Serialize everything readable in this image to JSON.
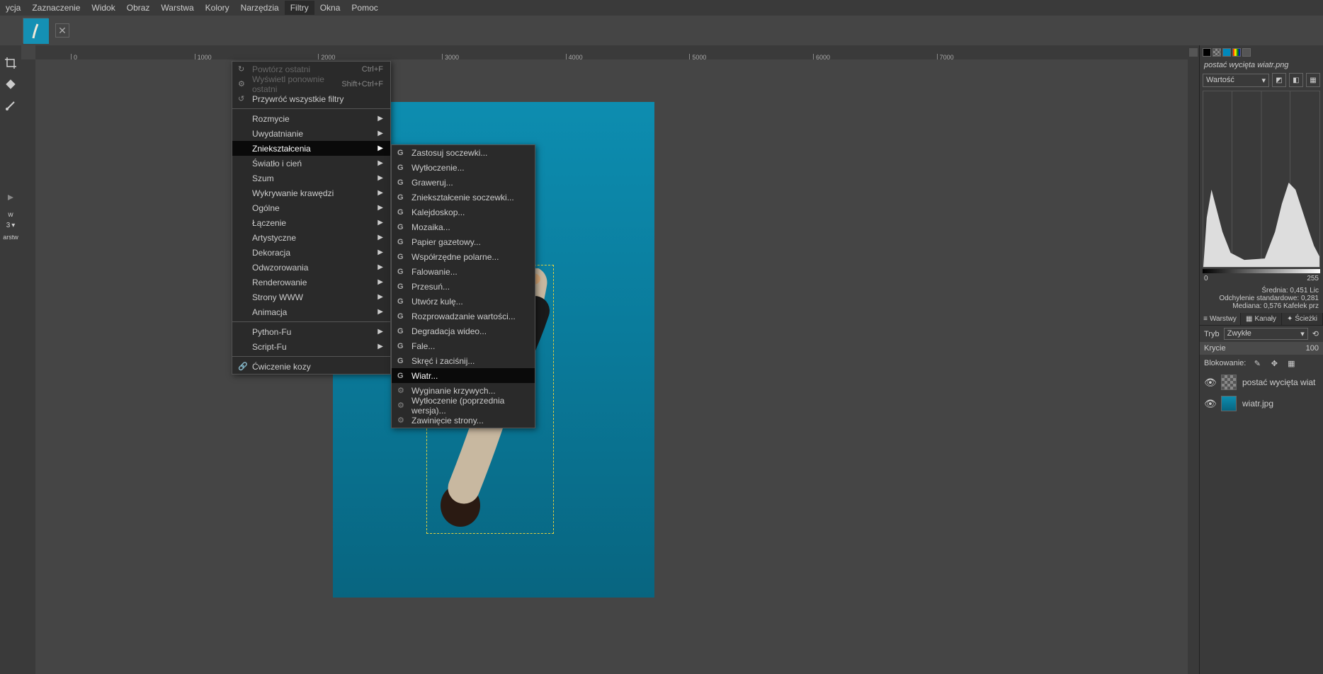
{
  "menubar": [
    "ycja",
    "Zaznaczenie",
    "Widok",
    "Obraz",
    "Warstwa",
    "Kolory",
    "Narzędzia",
    "Filtry",
    "Okna",
    "Pomoc"
  ],
  "menubar_active_index": 7,
  "tab_filename": "postać wycięta wiatr.png",
  "menu1": {
    "items": [
      {
        "label": "Powtórz ostatni",
        "shortcut": "Ctrl+F",
        "disabled": true,
        "icon": "↻"
      },
      {
        "label": "Wyświetl ponownie ostatni",
        "shortcut": "Shift+Ctrl+F",
        "disabled": true,
        "icon": "⚙"
      },
      {
        "label": "Przywróć wszystkie filtry",
        "icon": "↺"
      },
      {
        "sep": true
      },
      {
        "label": "Rozmycie",
        "arrow": true
      },
      {
        "label": "Uwydatnianie",
        "arrow": true
      },
      {
        "label": "Zniekształcenia",
        "arrow": true,
        "highlighted": true
      },
      {
        "label": "Światło i cień",
        "arrow": true
      },
      {
        "label": "Szum",
        "arrow": true
      },
      {
        "label": "Wykrywanie krawędzi",
        "arrow": true
      },
      {
        "label": "Ogólne",
        "arrow": true
      },
      {
        "label": "Łączenie",
        "arrow": true
      },
      {
        "label": "Artystyczne",
        "arrow": true
      },
      {
        "label": "Dekoracja",
        "arrow": true
      },
      {
        "label": "Odwzorowania",
        "arrow": true
      },
      {
        "label": "Renderowanie",
        "arrow": true
      },
      {
        "label": "Strony WWW",
        "arrow": true
      },
      {
        "label": "Animacja",
        "arrow": true
      },
      {
        "sep": true
      },
      {
        "label": "Python-Fu",
        "arrow": true
      },
      {
        "label": "Script-Fu",
        "arrow": true
      },
      {
        "sep": true
      },
      {
        "label": "Ćwiczenie kozy",
        "icon": "🔗"
      }
    ]
  },
  "menu2": {
    "items": [
      {
        "label": "Zastosuj soczewki...",
        "g": true
      },
      {
        "label": "Wytłoczenie...",
        "g": true
      },
      {
        "label": "Graweruj...",
        "g": true
      },
      {
        "label": "Zniekształcenie soczewki...",
        "g": true
      },
      {
        "label": "Kalejdoskop...",
        "g": true
      },
      {
        "label": "Mozaika...",
        "g": true
      },
      {
        "label": "Papier gazetowy...",
        "g": true
      },
      {
        "label": "Współrzędne polarne...",
        "g": true
      },
      {
        "label": "Falowanie...",
        "g": true
      },
      {
        "label": "Przesuń...",
        "g": true
      },
      {
        "label": "Utwórz kulę...",
        "g": true
      },
      {
        "label": "Rozprowadzanie wartości...",
        "g": true
      },
      {
        "label": "Degradacja wideo...",
        "g": true
      },
      {
        "label": "Fale...",
        "g": true
      },
      {
        "label": "Skręć i zaciśnij...",
        "g": true
      },
      {
        "label": "Wiatr...",
        "g": true,
        "highlighted": true
      },
      {
        "label": "Wyginanie krzywych...",
        "icon": "⚙"
      },
      {
        "label": "Wytłoczenie (poprzednia wersja)...",
        "icon": "⚙"
      },
      {
        "label": "Zawinięcie strony...",
        "icon": "⚙"
      }
    ]
  },
  "ruler_ticks": [
    0,
    1000,
    2000,
    3000,
    4000,
    5000,
    6000,
    7000
  ],
  "histogram": {
    "label": "Wartość",
    "min": "0",
    "max": "255",
    "stats": {
      "Średnia:": "0,451",
      "Odchylenie standardowe:": "0,281",
      "Mediana:": "0,576"
    },
    "stats_right": {
      "r1": "Lic",
      "r2": "Kafelek prz"
    }
  },
  "layer_tabs": [
    "Warstwy",
    "Kanały",
    "Ścieżki"
  ],
  "mode_label": "Tryb",
  "mode_value": "Zwykłe",
  "opacity_label": "Krycie",
  "opacity_value": "100",
  "lock_label": "Blokowanie:",
  "layers": [
    {
      "name": "postać wycięta wiat",
      "checker": true
    },
    {
      "name": "wiatr.jpg",
      "checker": false
    }
  ],
  "left_side": {
    "val3": "3",
    "arstw": "arstw"
  }
}
